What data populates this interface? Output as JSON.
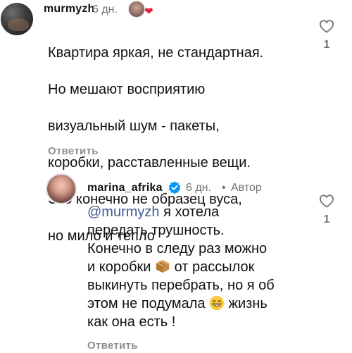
{
  "comment1": {
    "username": "murmyzh",
    "time": "6 дн.",
    "lines": [
      "Квартира яркая, не стандартная.",
      "Но мешают восприятию",
      "визуальный шум - пакеты,",
      "коробки, расставленные вещи.",
      "Это конечно не образец вуса,",
      "но мило и тепло"
    ],
    "reply_label": "Ответить",
    "like_count": "1",
    "liked_by_author_icon": "heart-icon"
  },
  "comment2": {
    "username": "marina_afrika",
    "time": "6 дн.",
    "separator": "•",
    "author_badge": "Автор",
    "mention": "@murmyzh",
    "line1_rest": " я хотела",
    "line2": "передать трушность.",
    "line3": "Конечно в следу раз можно",
    "line4_a": "и коробки ",
    "line4_b": " от рассылок",
    "line5": "выкинуть перебрать, но я об",
    "line6_a": "этом не подумала ",
    "line6_b": " жизнь",
    "line7": "как она есть !",
    "reply_label": "Ответить",
    "like_count": "1"
  },
  "colors": {
    "username": "#111111",
    "meta": "#737373",
    "reply": "#8e8e8e",
    "mention": "#3f5b8f",
    "verified": "#0095f6",
    "heart": "#ed1c36"
  }
}
